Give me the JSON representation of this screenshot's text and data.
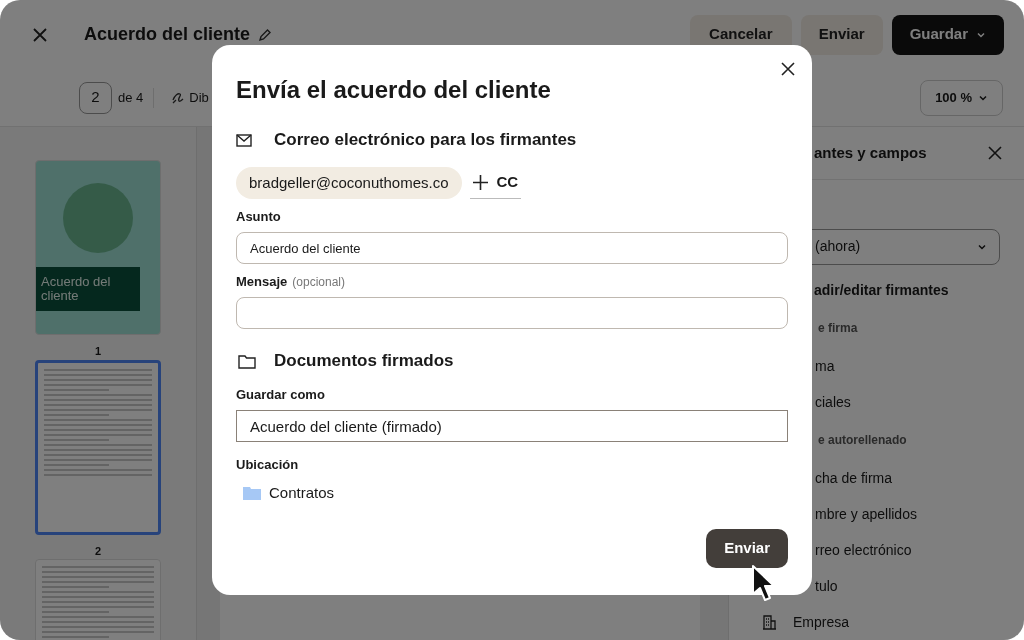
{
  "app_bar": {
    "title": "Acuerdo del cliente",
    "buttons": [
      {
        "label": "Cancelar",
        "kind": "secondary"
      },
      {
        "label": "Enviar",
        "kind": "secondary"
      },
      {
        "label": "Guardar",
        "kind": "primary"
      }
    ]
  },
  "toolbar": {
    "page_value": "2",
    "page_total": "de 4",
    "draw_tool": "Dib",
    "zoom": "100 %"
  },
  "thumbnails": [
    {
      "kind": "cover",
      "title": "Acuerdo del cliente",
      "number": "1",
      "selected": false
    },
    {
      "kind": "text",
      "number": "2",
      "selected": true
    },
    {
      "kind": "text",
      "selected": false
    }
  ],
  "side_panel": {
    "title": "antes y campos",
    "dropdown": "(ahora)",
    "items": [
      {
        "kind": "action",
        "label": "adir/editar firmantes"
      },
      {
        "kind": "heading",
        "label": "e firma"
      },
      {
        "kind": "field",
        "label": "ma"
      },
      {
        "kind": "field",
        "label": "ciales"
      },
      {
        "kind": "heading",
        "label": "e autorellenado"
      },
      {
        "kind": "field",
        "label": "cha de firma"
      },
      {
        "kind": "field",
        "label": "mbre y apellidos"
      },
      {
        "kind": "field",
        "label": "rreo electrónico"
      },
      {
        "kind": "field",
        "label": "tulo"
      },
      {
        "kind": "company",
        "label": "Empresa"
      }
    ]
  },
  "dialog": {
    "title": "Envía el acuerdo del cliente",
    "email_section": {
      "heading": "Correo electrónico para los firmantes",
      "recipients": [
        "bradgeller@coconuthomes.co"
      ],
      "cc": "CC",
      "subject": {
        "label": "Asunto",
        "value": "Acuerdo del cliente"
      },
      "message": {
        "label": "Mensaje",
        "hint": "(opcional)"
      }
    },
    "documents_section": {
      "heading": "Documentos firmados",
      "save_as": {
        "label": "Guardar como",
        "value": "Acuerdo del cliente (firmado)"
      },
      "location": {
        "label": "Ubicación",
        "folder": "Contratos"
      }
    },
    "send_button": "Enviar"
  }
}
